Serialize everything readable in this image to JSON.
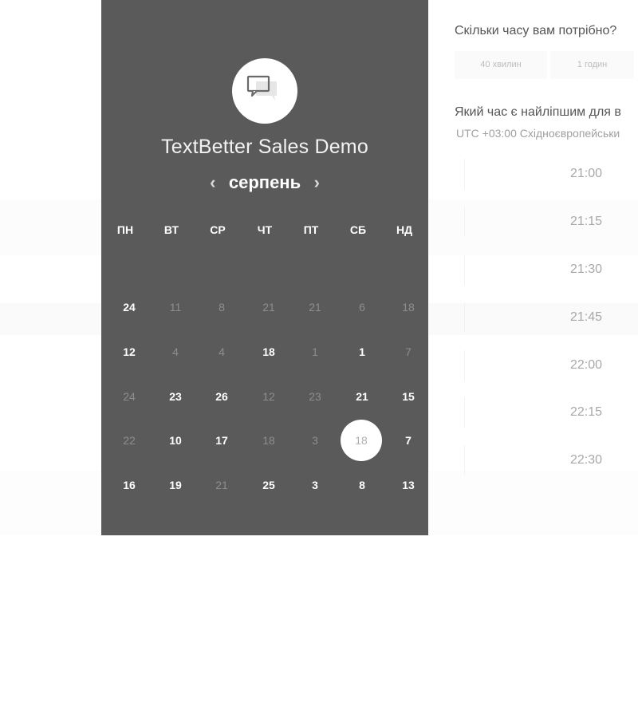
{
  "widget": {
    "title": "TextBetter Sales Demo",
    "month": "серпень",
    "prev_icon": "chevron-left-icon",
    "next_icon": "chevron-right-icon",
    "avatar_icon": "chat-bubbles-icon"
  },
  "weekdays": [
    "ПН",
    "ВТ",
    "СР",
    "ЧТ",
    "ПТ",
    "СБ",
    "НД"
  ],
  "calendar": {
    "weeks": [
      [
        {
          "d": "24",
          "on": true
        },
        {
          "d": "11",
          "on": false
        },
        {
          "d": "8",
          "on": false
        },
        {
          "d": "21",
          "on": false
        },
        {
          "d": "21",
          "on": false
        },
        {
          "d": "6",
          "on": false
        },
        {
          "d": "18",
          "on": false
        }
      ],
      [
        {
          "d": "12",
          "on": true
        },
        {
          "d": "4",
          "on": false
        },
        {
          "d": "4",
          "on": false
        },
        {
          "d": "18",
          "on": true
        },
        {
          "d": "1",
          "on": false
        },
        {
          "d": "1",
          "on": true
        },
        {
          "d": "7",
          "on": false
        }
      ],
      [
        {
          "d": "24",
          "on": false
        },
        {
          "d": "23",
          "on": true
        },
        {
          "d": "26",
          "on": true
        },
        {
          "d": "12",
          "on": false
        },
        {
          "d": "23",
          "on": false
        },
        {
          "d": "21",
          "on": true
        },
        {
          "d": "15",
          "on": true
        }
      ],
      [
        {
          "d": "22",
          "on": false
        },
        {
          "d": "10",
          "on": true
        },
        {
          "d": "17",
          "on": true
        },
        {
          "d": "18",
          "on": false
        },
        {
          "d": "3",
          "on": false
        },
        {
          "d": "18",
          "on": false,
          "selected": true
        },
        {
          "d": "7",
          "on": true
        }
      ],
      [
        {
          "d": "16",
          "on": true
        },
        {
          "d": "19",
          "on": true
        },
        {
          "d": "21",
          "on": false
        },
        {
          "d": "25",
          "on": true
        },
        {
          "d": "3",
          "on": true
        },
        {
          "d": "8",
          "on": true
        },
        {
          "d": "13",
          "on": true
        }
      ]
    ]
  },
  "duration": {
    "question": "Скільки часу вам потрібно?",
    "options": [
      "40 хвилин",
      "1 годин"
    ]
  },
  "times": {
    "question": "Який час є найліпшим для в",
    "timezone": "UTC +03:00 Східноєвропейськи",
    "slots": [
      "21:00",
      "21:15",
      "21:30",
      "21:45",
      "22:00",
      "22:15",
      "22:30"
    ]
  },
  "colors": {
    "panel_bg": "#5a5a5a",
    "page_bg": "#ffffff",
    "selected_day_bg": "#ffffff"
  }
}
